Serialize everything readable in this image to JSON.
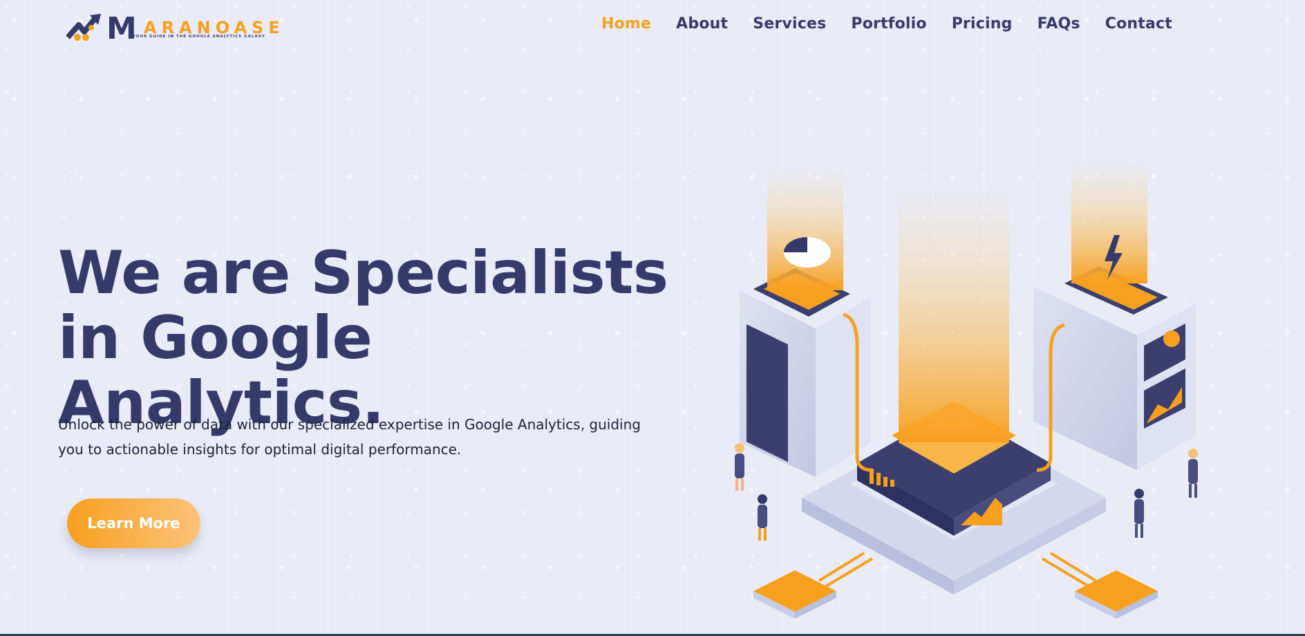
{
  "header": {
    "logo": {
      "wordmark": "ARANOASE",
      "initial": "M",
      "tagline": "YOUR GUIDE IN THE GOOGLE ANALYTICS GALAXY"
    },
    "nav": [
      {
        "label": "Home",
        "active": true
      },
      {
        "label": "About",
        "active": false
      },
      {
        "label": "Services",
        "active": false
      },
      {
        "label": "Portfolio",
        "active": false
      },
      {
        "label": "Pricing",
        "active": false
      },
      {
        "label": "FAQs",
        "active": false
      },
      {
        "label": "Contact",
        "active": false
      }
    ]
  },
  "hero": {
    "title_lines": [
      "We are Specialists",
      "in Google",
      "Analytics."
    ],
    "subtitle": "Unlock the power of data with our specialized expertise in Google Analytics, guiding you to actionable insights for optimal digital performance.",
    "cta_label": "Learn More"
  },
  "colors": {
    "background": "#e9ebf6",
    "primary_text": "#363a6a",
    "accent": "#f7a020",
    "active_nav": "#f7a020"
  },
  "icons": [
    "logo-arrow-icon",
    "pie-chart-icon",
    "lightning-icon",
    "bar-chart-icon",
    "area-chart-icon"
  ]
}
